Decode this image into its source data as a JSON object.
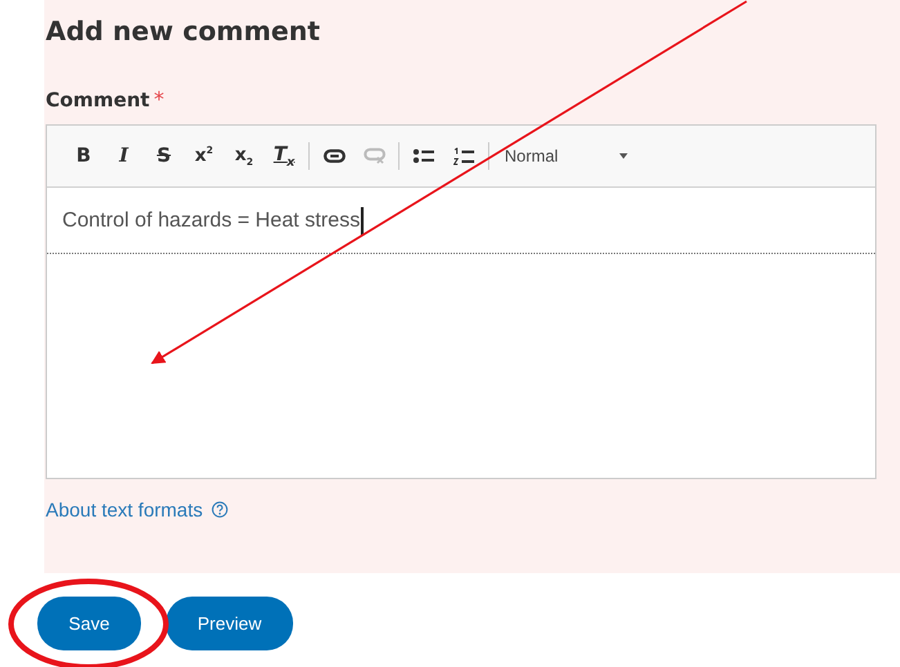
{
  "heading": "Add new comment",
  "field": {
    "label": "Comment",
    "required": true,
    "required_mark": "*"
  },
  "toolbar": [
    {
      "kind": "bold",
      "label": "B",
      "disabled": false
    },
    {
      "kind": "italic",
      "label": "I",
      "disabled": false
    },
    {
      "kind": "strike",
      "label": "S",
      "disabled": false
    },
    {
      "kind": "super",
      "label": "x$^{2}$",
      "disabled": false
    },
    {
      "kind": "sub",
      "label": "x$_{2}$",
      "disabled": false
    },
    {
      "kind": "clear",
      "label": "T$_{x}$",
      "disabled": false
    },
    {
      "kind": "separator"
    },
    {
      "kind": "link",
      "disabled": false
    },
    {
      "kind": "unlink",
      "disabled": true
    },
    {
      "kind": "separator"
    },
    {
      "kind": "bullets",
      "disabled": false
    },
    {
      "kind": "numbers",
      "disabled": false
    },
    {
      "kind": "separator"
    },
    {
      "kind": "format",
      "label": "Normal",
      "disabled": false
    }
  ],
  "editor": {
    "value": "Control of hazards = Heat stress"
  },
  "help_link": "About text formats",
  "buttons": [
    {
      "label": "Save"
    },
    {
      "label": "Preview"
    }
  ]
}
